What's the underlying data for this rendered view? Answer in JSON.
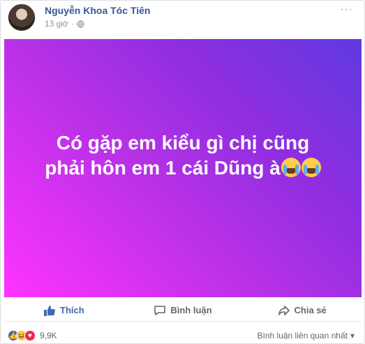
{
  "post": {
    "author": "Nguyễn Khoa Tóc Tiên",
    "time": "13 giờ",
    "privacy_icon": "globe-icon",
    "more_label": "···",
    "text_line1": "Có gặp em kiểu gì chị cũng",
    "text_line2": "phải hôn em 1 cái Dũng à",
    "background_colors": [
      "#ff33ff",
      "#b431e6",
      "#5e3ae0"
    ]
  },
  "actions": {
    "like_label": "Thích",
    "comment_label": "Bình luận",
    "share_label": "Chia sẻ"
  },
  "footer": {
    "reaction_icons": [
      "like-icon",
      "haha-icon",
      "love-icon"
    ],
    "reaction_count": "9,9K",
    "sort_label": "Bình luận liên quan nhất"
  },
  "colors": {
    "link": "#365899",
    "like": "#4267b2",
    "muted": "#90949c"
  }
}
